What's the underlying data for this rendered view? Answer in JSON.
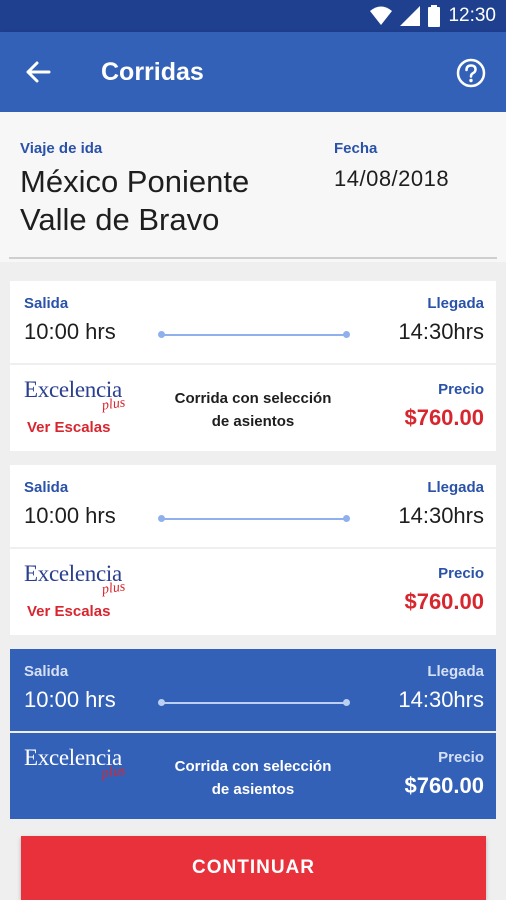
{
  "status_bar": {
    "time": "12:30",
    "icons": [
      "wifi-icon",
      "signal-icon",
      "battery-icon"
    ]
  },
  "app_bar": {
    "title": "Corridas",
    "back_icon": "arrow-left-icon",
    "help_icon": "help-circle-icon"
  },
  "trip": {
    "label": "Viaje de ida",
    "origin": "México Poniente",
    "destination": "Valle de Bravo",
    "date_label": "Fecha",
    "date": "14/08/2018"
  },
  "routes": [
    {
      "departure_label": "Salida",
      "departure_time": "10:00 hrs",
      "arrival_label": "Llegada",
      "arrival_time": "14:30hrs",
      "logo_text": "Excelencia",
      "logo_subtext": "plus",
      "stops_link": "Ver Escalas",
      "note_line1": "Corrida con selección",
      "note_line2": "de asientos",
      "price_label": "Precio",
      "price": "$760.00",
      "selected": false
    },
    {
      "departure_label": "Salida",
      "departure_time": "10:00 hrs",
      "arrival_label": "Llegada",
      "arrival_time": "14:30hrs",
      "logo_text": "Excelencia",
      "logo_subtext": "plus",
      "stops_link": "Ver Escalas",
      "price_label": "Precio",
      "price": "$760.00",
      "selected": false
    },
    {
      "departure_label": "Salida",
      "departure_time": "10:00 hrs",
      "arrival_label": "Llegada",
      "arrival_time": "14:30hrs",
      "logo_text": "Excelencia",
      "logo_subtext": "plus",
      "note_line1": "Corrida con selección",
      "note_line2": "de asientos",
      "price_label": "Precio",
      "price": "$760.00",
      "selected": true
    }
  ],
  "continue_button": "CONTINUAR",
  "colors": {
    "status_bar": "#1f3f8f",
    "primary": "#3461b8",
    "accent_red": "#e8313b",
    "price_red": "#d8262f",
    "label_blue": "#2a52a8"
  }
}
